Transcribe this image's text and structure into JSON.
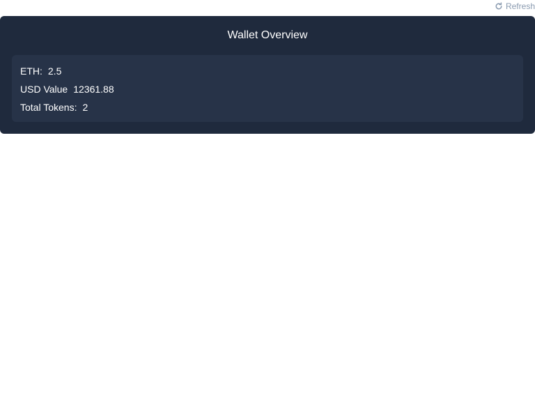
{
  "toolbar": {
    "refresh_label": "Refresh",
    "refresh_icon": "refresh-icon"
  },
  "wallet": {
    "title": "Wallet Overview",
    "rows": [
      {
        "label": "ETH:",
        "value": "2.5"
      },
      {
        "label": "USD Value",
        "value": "12361.88"
      },
      {
        "label": "Total Tokens:",
        "value": "2"
      }
    ]
  },
  "colors": {
    "card_bg": "#1f2a3d",
    "panel_bg": "#273348",
    "refresh_text": "#8a9bb0"
  }
}
